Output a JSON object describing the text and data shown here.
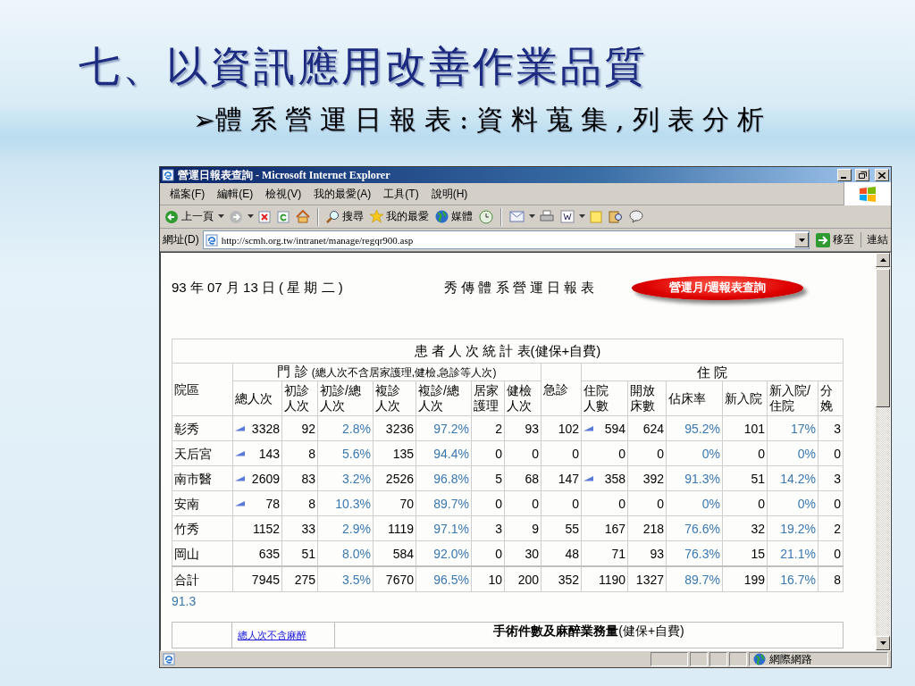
{
  "slide": {
    "title": "七、以資訊應用改善作業品質",
    "bullet": "➢",
    "subtitle": "體系營運日報表:資料蒐集,列表分析"
  },
  "window": {
    "title": "營運日報表查詢 - Microsoft Internet Explorer"
  },
  "menu": [
    "檔案(F)",
    "編輯(E)",
    "檢視(V)",
    "我的最愛(A)",
    "工具(T)",
    "說明(H)"
  ],
  "toolbar": [
    "上一頁",
    "搜尋",
    "我的最愛",
    "媒體"
  ],
  "address": {
    "label": "網址(D)",
    "url": "http://scmh.org.tw/intranet/manage/regqr900.asp",
    "go": "移至",
    "links": "連結"
  },
  "page": {
    "date": "93 年 07 月 13 日 ( 星 期 二 )",
    "report_title": "秀 傳 體 系 營 運 日 報 表",
    "query_button": "營運月/週報表查詢"
  },
  "table": {
    "title": "患 者 人 次 統 計 表(健保+自費)",
    "site_header": "院區",
    "header": [
      {
        "kind": "group",
        "label": "門 診",
        "note": "(總人次不含居家護理,健檢,急診等人次)",
        "columns": [
          {
            "label": "總人次",
            "kind": "number"
          },
          {
            "label": "初診人次",
            "kind": "number"
          },
          {
            "label": "初診/總人次",
            "kind": "percent"
          },
          {
            "label": "複診人次",
            "kind": "number"
          },
          {
            "label": "複診/總人次",
            "kind": "percent"
          },
          {
            "label": "居家護理",
            "kind": "number"
          },
          {
            "label": "健檢人次",
            "kind": "number"
          }
        ]
      },
      {
        "kind": "single",
        "label": "急診"
      },
      {
        "kind": "group",
        "label": "住 院",
        "columns": [
          {
            "label": "住院人數",
            "kind": "number"
          },
          {
            "label": "開放床數",
            "kind": "number"
          },
          {
            "label": "佔床率",
            "kind": "percent"
          },
          {
            "label": "新入院",
            "kind": "number"
          },
          {
            "label": "新入院/住院",
            "kind": "percent"
          },
          {
            "label": "分娩",
            "kind": "number"
          }
        ]
      }
    ],
    "rows": [
      {
        "site": "彰秀",
        "kind": "site",
        "outpatient_trend": true,
        "inpatient_trend": true,
        "cells": [
          "3328",
          "92",
          "2.8%",
          "3236",
          "97.2%",
          "2",
          "93",
          "102",
          "594",
          "624",
          "95.2%",
          "101",
          "17%",
          "3"
        ]
      },
      {
        "site": "天后宮",
        "kind": "site",
        "outpatient_trend": true,
        "inpatient_trend": false,
        "cells": [
          "143",
          "8",
          "5.6%",
          "135",
          "94.4%",
          "0",
          "0",
          "0",
          "0",
          "0",
          "0%",
          "0",
          "0%",
          "0"
        ]
      },
      {
        "site": "南市醫",
        "kind": "site",
        "outpatient_trend": true,
        "inpatient_trend": true,
        "cells": [
          "2609",
          "83",
          "3.2%",
          "2526",
          "96.8%",
          "5",
          "68",
          "147",
          "358",
          "392",
          "91.3%",
          "51",
          "14.2%",
          "3"
        ]
      },
      {
        "site": "安南",
        "kind": "site",
        "outpatient_trend": true,
        "inpatient_trend": false,
        "cells": [
          "78",
          "8",
          "10.3%",
          "70",
          "89.7%",
          "0",
          "0",
          "0",
          "0",
          "0",
          "0%",
          "0",
          "0%",
          "0"
        ]
      },
      {
        "site": "竹秀",
        "kind": "site",
        "outpatient_trend": false,
        "inpatient_trend": false,
        "cells": [
          "1152",
          "33",
          "2.9%",
          "1119",
          "97.1%",
          "3",
          "9",
          "55",
          "167",
          "218",
          "76.6%",
          "32",
          "19.2%",
          "2"
        ]
      },
      {
        "site": "岡山",
        "kind": "site",
        "outpatient_trend": false,
        "inpatient_trend": false,
        "cells": [
          "635",
          "51",
          "8.0%",
          "584",
          "92.0%",
          "0",
          "30",
          "48",
          "71",
          "93",
          "76.3%",
          "15",
          "21.1%",
          "0"
        ]
      },
      {
        "site": "合計",
        "kind": "total",
        "outpatient_trend": false,
        "inpatient_trend": false,
        "cells": [
          "7945",
          "275",
          "3.5%",
          "7670",
          "96.5%",
          "10",
          "200",
          "352",
          "1190",
          "1327",
          "89.7%",
          "199",
          "16.7%",
          "8"
        ]
      }
    ],
    "footnote": "91.3"
  },
  "second_table": {
    "link": "總人次不含麻醉",
    "title": "**手術件數及麻醉業務量**(健保+自費)"
  },
  "status_bar": {
    "zone": "網際網路"
  }
}
